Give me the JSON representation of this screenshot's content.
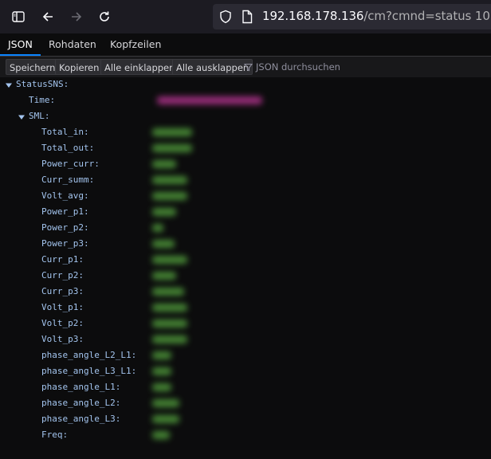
{
  "browser": {
    "url_host": "192.168.178.136",
    "url_path": "/cm?cmnd=status 10"
  },
  "tabs": [
    "JSON",
    "Rohdaten",
    "Kopfzeilen"
  ],
  "toolbar": {
    "save": "Speichern",
    "copy": "Kopieren",
    "collapse_all": "Alle einklappen",
    "expand_all": "Alle ausklappen",
    "filter_placeholder": "JSON durchsuchen"
  },
  "tree": {
    "root": "StatusSNS:",
    "time": "Time:",
    "sml": "SML:",
    "fields": [
      "Total_in:",
      "Total_out:",
      "Power_curr:",
      "Curr_summ:",
      "Volt_avg:",
      "Power_p1:",
      "Power_p2:",
      "Power_p3:",
      "Curr_p1:",
      "Curr_p2:",
      "Curr_p3:",
      "Volt_p1:",
      "Volt_p2:",
      "Volt_p3:",
      "phase_angle_L2_L1:",
      "phase_angle_L3_L1:",
      "phase_angle_L1:",
      "phase_angle_L2:",
      "phase_angle_L3:",
      "Freq:"
    ]
  },
  "colors": {
    "key": "#a3c4ee",
    "accent": "#0a84ff",
    "blurred_number": "#4f9a3b",
    "blurred_string": "#b0338c"
  }
}
